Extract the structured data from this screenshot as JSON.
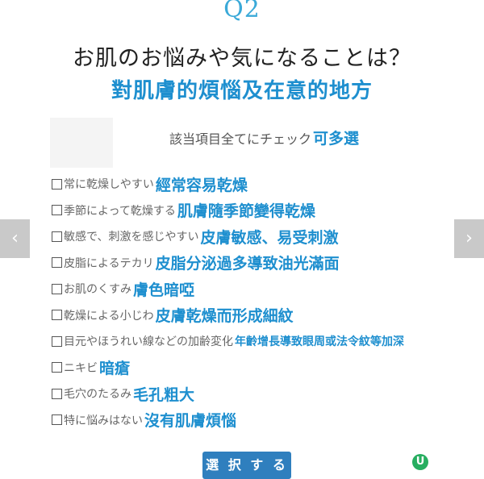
{
  "header": {
    "question_label": "Q2",
    "title_jp": "お肌のお悩みや気になることは？",
    "title_zh": "對肌膚的煩惱及在意的地方"
  },
  "instruction": {
    "jp": "該当項目全てにチェック",
    "zh": "可多選"
  },
  "options": [
    {
      "jp": "常に乾燥しやすい",
      "zh": "經常容易乾燥"
    },
    {
      "jp": "季節によって乾燥する",
      "zh": "肌膚隨季節變得乾燥"
    },
    {
      "jp": "敏感で、刺激を感じやすい",
      "zh": "皮膚敏感、易受刺激"
    },
    {
      "jp": "皮脂によるテカリ",
      "zh": "皮脂分泌過多導致油光滿面"
    },
    {
      "jp": "お肌のくすみ",
      "zh": "膚色暗啞"
    },
    {
      "jp": "乾燥による小じわ",
      "zh": "皮膚乾燥而形成細紋"
    },
    {
      "jp": "目元やほうれい線などの加齢変化",
      "zh": "年齡增長導致眼周或法令紋等加深"
    },
    {
      "jp": "ニキビ",
      "zh": "暗瘡"
    },
    {
      "jp": "毛穴のたるみ",
      "zh": "毛孔粗大"
    },
    {
      "jp": "特に悩みはない",
      "zh": "沒有肌膚煩惱"
    }
  ],
  "buttons": {
    "select_label": "選 択 す る",
    "prev_glyph": "‹",
    "next_glyph": "›"
  },
  "brand": {
    "logo_letter": "U"
  }
}
